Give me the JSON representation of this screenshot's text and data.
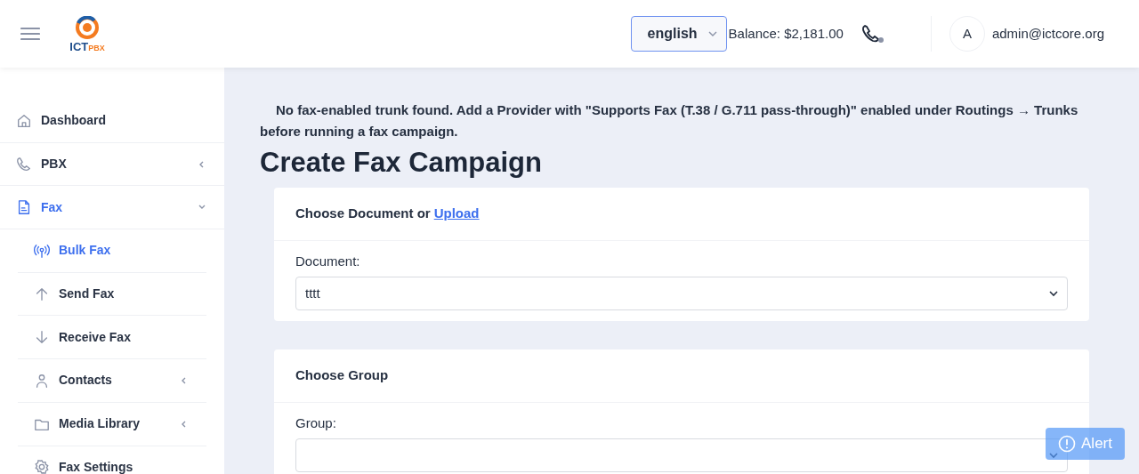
{
  "header": {
    "logo": [
      "ICT",
      "PBX"
    ],
    "language": "english",
    "balance": "Balance: $2,181.00",
    "avatar_letter": "A",
    "user": "admin@ictcore.org"
  },
  "sidebar": {
    "items": [
      {
        "label": "Dashboard",
        "selected": false
      },
      {
        "label": "PBX",
        "selected": false,
        "expanded": false
      },
      {
        "label": "Fax",
        "selected": true,
        "expanded": true,
        "children": [
          {
            "label": "Bulk Fax",
            "selected": true
          },
          {
            "label": "Send Fax",
            "selected": false
          },
          {
            "label": "Receive Fax",
            "selected": false
          },
          {
            "label": "Contacts",
            "selected": false,
            "expanded": false
          },
          {
            "label": "Media Library",
            "selected": false,
            "expanded": false
          },
          {
            "label": "Fax Settings",
            "selected": false
          }
        ]
      }
    ]
  },
  "notice": "No fax-enabled trunk found. Add a Provider with \"Supports Fax (T.38 / G.711 pass-through)\" enabled under Routings → Trunks before running a fax campaign.",
  "title": "Create Fax Campaign",
  "cards": [
    {
      "heading": "Choose Document or",
      "link": "Upload",
      "label": "Document:",
      "value": "tttt"
    },
    {
      "heading": "Choose Group",
      "label": "Group:"
    }
  ],
  "alert_button": "Alert"
}
